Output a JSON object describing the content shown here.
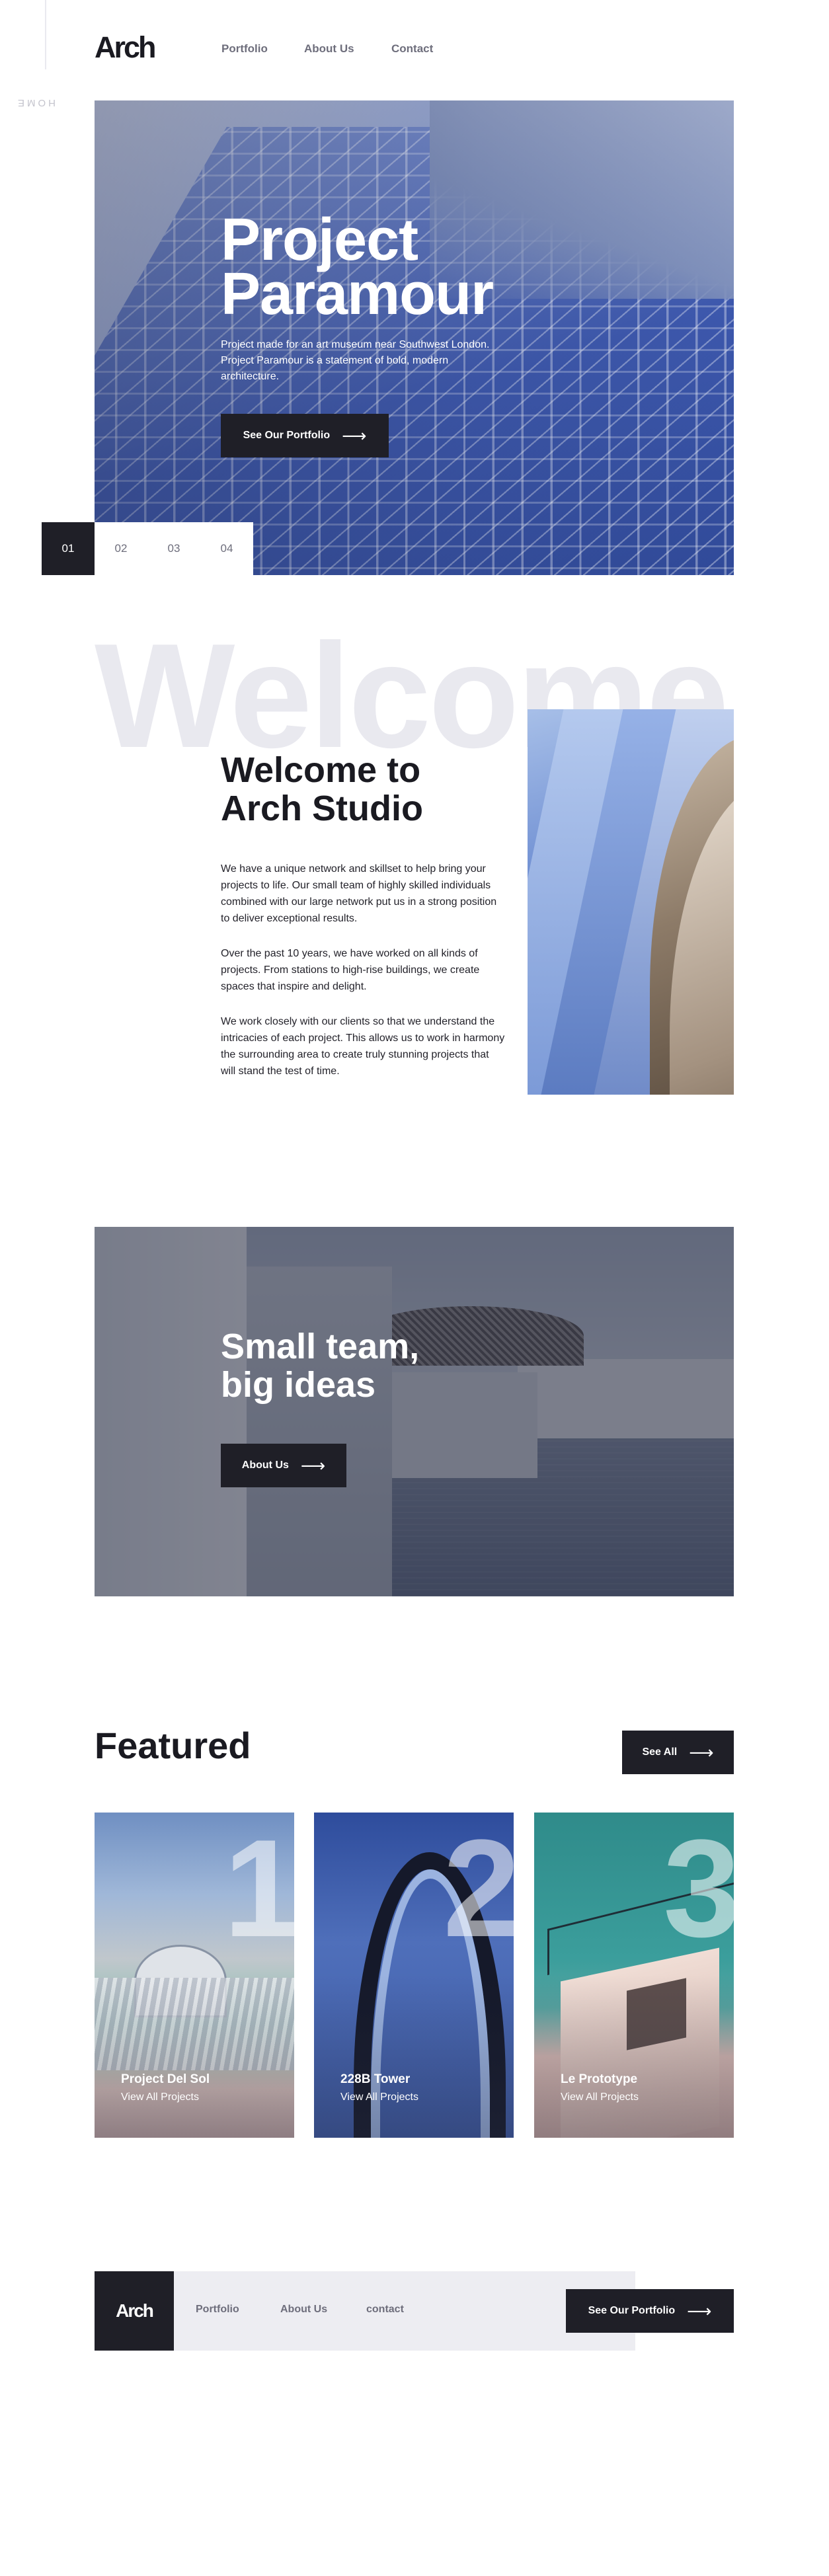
{
  "side": {
    "home_label": "HOME"
  },
  "header": {
    "logo": "Arch",
    "nav": [
      "Portfolio",
      "About Us",
      "Contact"
    ]
  },
  "hero": {
    "title_line1": "Project",
    "title_line2": "Paramour",
    "text": "Project made for an art museum near Southwest London. Project Paramour is a statement of bold, modern architecture.",
    "button": "See Our Portfolio",
    "slides": [
      "01",
      "02",
      "03",
      "04"
    ],
    "active_slide": "01"
  },
  "welcome": {
    "bg_word": "Welcome",
    "title_line1": "Welcome to",
    "title_line2": "Arch Studio",
    "paragraphs": [
      "We have a unique network and skillset to help bring your projects to life. Our small team of highly skilled individuals combined with our large network put us in a strong position to deliver exceptional results.",
      "Over the past 10 years, we have worked on all kinds of projects. From stations to high-rise buildings, we create spaces that inspire and delight.",
      "We work closely with our clients so that we understand the intricacies of each project. This allows us to work in harmony the surrounding area to create truly stunning projects that will stand the test of time."
    ]
  },
  "team": {
    "title_line1": "Small team,",
    "title_line2": "big ideas",
    "button": "About Us"
  },
  "featured": {
    "title": "Featured",
    "see_all": "See All",
    "cards": [
      {
        "number": "1",
        "name": "Project Del Sol",
        "link": "View All Projects"
      },
      {
        "number": "2",
        "name": "228B Tower",
        "link": "View All Projects"
      },
      {
        "number": "3",
        "name": "Le Prototype",
        "link": "View All Projects"
      }
    ]
  },
  "footer": {
    "logo": "Arch",
    "nav": [
      "Portfolio",
      "About Us",
      "contact"
    ],
    "button": "See Our Portfolio"
  },
  "colors": {
    "dark": "#1f1f27",
    "light_gray": "#ededf2",
    "muted_text": "#6e6e7c",
    "welcome_bg_text": "#e9e9ef"
  }
}
